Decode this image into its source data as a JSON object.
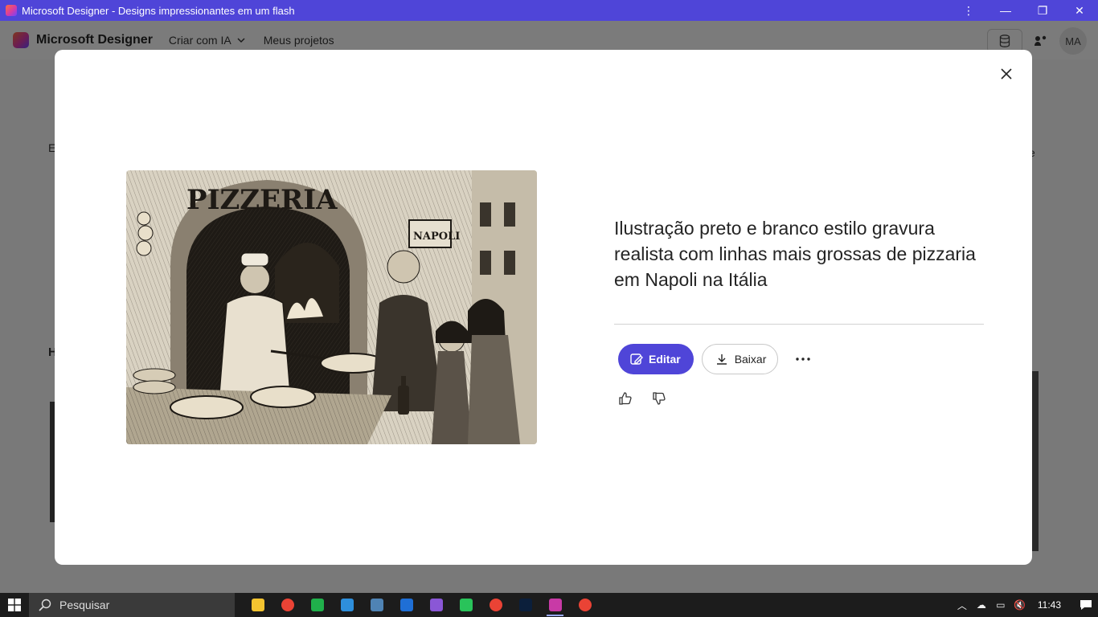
{
  "window": {
    "title": "Microsoft Designer - Designs impressionantes em um flash",
    "controls": {
      "more": "⋮",
      "minimize": "—",
      "restore": "❐",
      "close": "✕"
    }
  },
  "app": {
    "brand": "Microsoft Designer",
    "nav": [
      {
        "label": "Criar com IA",
        "icon": "chevron-down-icon"
      },
      {
        "label": "Meus projetos"
      }
    ],
    "account": {
      "initials": "MA"
    },
    "background_fragments": {
      "a": "E",
      "b": "H",
      "c": "e"
    }
  },
  "modal": {
    "prompt": "Ilustração preto e branco estilo gravura realista com linhas mais grossas de pizzaria em Napoli na Itália",
    "image": {
      "sign_main": "PIZZERIA",
      "sign_street": "NAPOLI"
    },
    "buttons": {
      "edit": "Editar",
      "download": "Baixar"
    },
    "accent_color": "#4f45d8"
  },
  "taskbar": {
    "search_placeholder": "Pesquisar",
    "apps": [
      {
        "name": "file-explorer-icon",
        "color": "#f4c430"
      },
      {
        "name": "chrome-icon",
        "color": "#ea4335"
      },
      {
        "name": "phone-app-icon",
        "color": "#20b04b"
      },
      {
        "name": "vscode-icon",
        "color": "#2e8fdc"
      },
      {
        "name": "sql-tool-icon",
        "color": "#4f83b4"
      },
      {
        "name": "trello-icon",
        "color": "#1f6fd6"
      },
      {
        "name": "github-desktop-icon",
        "color": "#8a57d6"
      },
      {
        "name": "whatsapp-icon",
        "color": "#29c35a"
      },
      {
        "name": "chrome-profile-icon",
        "color": "#ea4335"
      },
      {
        "name": "photoshop-icon",
        "color": "#0b1f3b"
      },
      {
        "name": "designer-icon",
        "color": "#c83aa6"
      },
      {
        "name": "chrome-alt-icon",
        "color": "#ea4335"
      }
    ],
    "time": "11:43"
  }
}
